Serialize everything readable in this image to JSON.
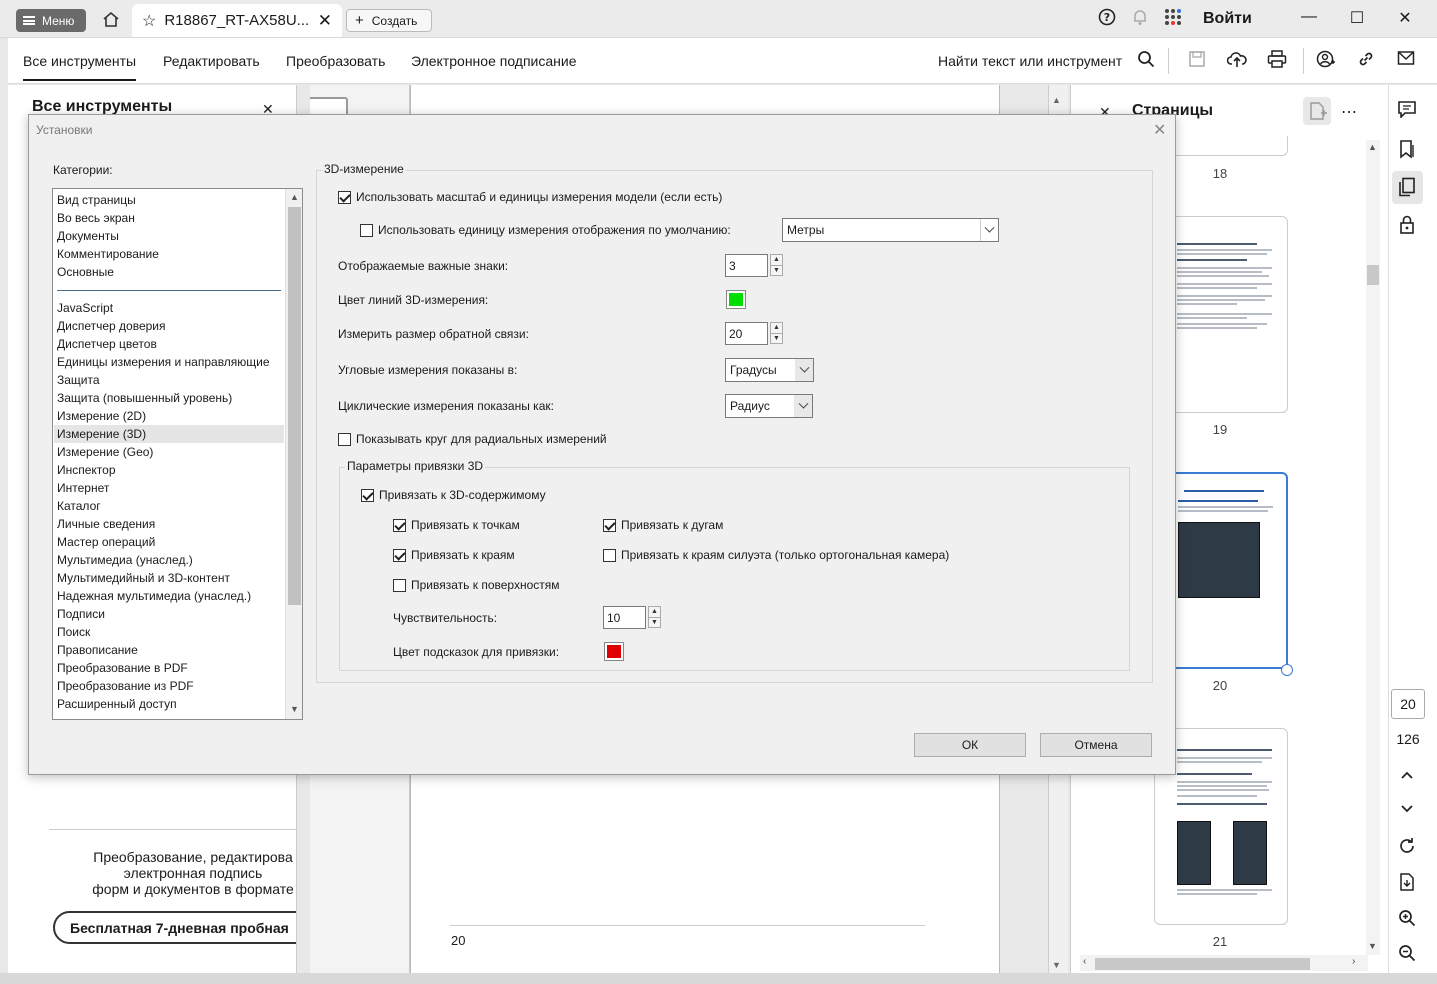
{
  "titlebar": {
    "menu_label": "Меню",
    "tab_title": "R18867_RT-AX58U...",
    "create_label": "Создать",
    "signin_label": "Войти"
  },
  "toolbar": {
    "tabs": [
      "Все инструменты",
      "Редактировать",
      "Преобразовать",
      "Электронное подписание"
    ],
    "search_label": "Найти текст или инструмент"
  },
  "left_panel": {
    "title": "Все инструменты",
    "promo_lines": [
      "Преобразование, редактирова",
      "электронная подпись",
      "форм и документов в формате"
    ],
    "trial_label": "Бесплатная 7-дневная пробная"
  },
  "document": {
    "page_number": "20"
  },
  "pages_panel": {
    "title": "Страницы",
    "thumb_numbers": [
      "18",
      "19",
      "20",
      "21"
    ]
  },
  "rail": {
    "current_page": "20",
    "total_pages": "126"
  },
  "dialog": {
    "title": "Установки",
    "categories_label": "Категории:",
    "categories_top": [
      "Вид страницы",
      "Во весь экран",
      "Документы",
      "Комментирование",
      "Основные"
    ],
    "categories": [
      "JavaScript",
      "Диспетчер доверия",
      "Диспетчер цветов",
      "Единицы измерения и направляющие",
      "Защита",
      "Защита (повышенный уровень)",
      "Измерение (2D)",
      "Измерение (3D)",
      "Измерение (Geo)",
      "Инспектор",
      "Интернет",
      "Каталог",
      "Личные сведения",
      "Мастер операций",
      "Мультимедиа (унаслед.)",
      "Мультимедийный и 3D-контент",
      "Надежная мультимедиа (унаслед.)",
      "Подписи",
      "Поиск",
      "Правописание",
      "Преобразование в PDF",
      "Преобразование из PDF",
      "Расширенный доступ"
    ],
    "selected_category": "Измерение (3D)",
    "group_title": "3D-измерение",
    "use_model_scale": {
      "label": "Использовать масштаб и единицы измерения модели (если есть)",
      "checked": true
    },
    "use_default_unit": {
      "label": "Использовать единицу измерения отображения по умолчанию:",
      "checked": false,
      "value": "Метры"
    },
    "significant_digits": {
      "label": "Отображаемые важные знаки:",
      "value": "3"
    },
    "line_color": {
      "label": "Цвет линий 3D-измерения:",
      "color": "#00dd00"
    },
    "feedback_size": {
      "label": "Измерить размер обратной связи:",
      "value": "20"
    },
    "angular": {
      "label": "Угловые измерения показаны в:",
      "value": "Градусы"
    },
    "circular": {
      "label": "Циклические измерения показаны как:",
      "value": "Радиус"
    },
    "show_circle": {
      "label": "Показывать круг для радиальных измерений",
      "checked": false
    },
    "snap_group_title": "Параметры привязки 3D",
    "snap_3d": {
      "label": "Привязать к 3D-содержимому",
      "checked": true
    },
    "snap_points": {
      "label": "Привязать к точкам",
      "checked": true
    },
    "snap_arcs": {
      "label": "Привязать к дугам",
      "checked": true
    },
    "snap_edges": {
      "label": "Привязать к краям",
      "checked": true
    },
    "snap_silhouette": {
      "label": "Привязать к краям силуэта (только ортогональная камера)",
      "checked": false
    },
    "snap_surfaces": {
      "label": "Привязать к поверхностям",
      "checked": false
    },
    "sensitivity": {
      "label": "Чувствительность:",
      "value": "10"
    },
    "hint_color": {
      "label": "Цвет подсказок для привязки:",
      "color": "#e00000"
    },
    "ok_label": "ОК",
    "cancel_label": "Отмена"
  }
}
